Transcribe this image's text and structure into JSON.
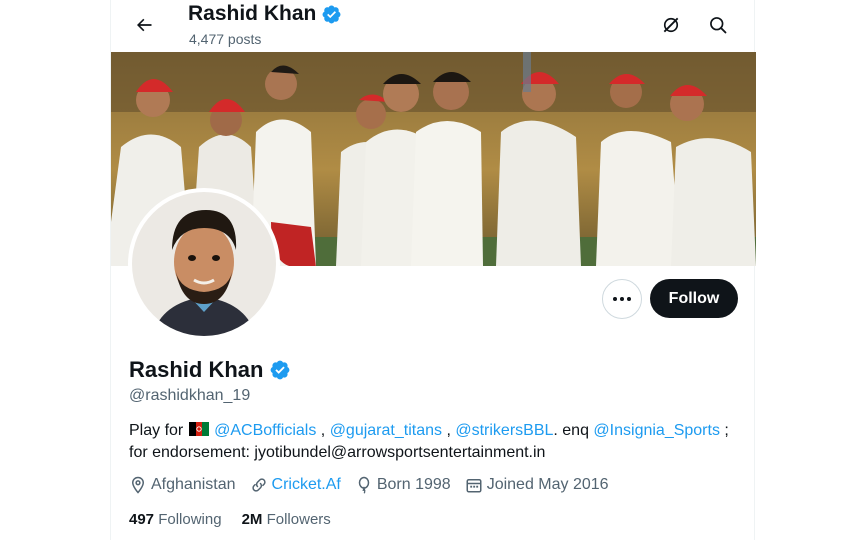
{
  "header": {
    "title": "Rashid Khan",
    "posts_count": "4,477 posts",
    "back_icon": "arrow-left-icon",
    "grok_icon": "grok-icon",
    "search_icon": "search-icon"
  },
  "profile": {
    "name": "Rashid Khan",
    "handle": "@rashidkhan_19",
    "verified": true,
    "bio": {
      "p1": "Play for ",
      "link1": "@ACBofficials",
      "p2": " , ",
      "link2": "@gujarat_titans",
      "p3": " ,  ",
      "link3": "@strikersBBL",
      "p4": ". enq ",
      "link4": "@Insignia_Sports",
      "p5": " ;",
      "line2": "for endorsement: jyotibundel@arrowsportsentertainment.in"
    },
    "location": "Afghanistan",
    "website": "Cricket.Af",
    "born": "Born 1998",
    "joined": "Joined May 2016",
    "following_count": "497",
    "following_label": "Following",
    "followers_count": "2M",
    "followers_label": "Followers"
  },
  "actions": {
    "follow_label": "Follow",
    "more_icon": "more-dots-icon"
  },
  "colors": {
    "accent": "#1d9bf0",
    "text": "#0f1419",
    "muted": "#536471",
    "button": "#0f1419"
  }
}
